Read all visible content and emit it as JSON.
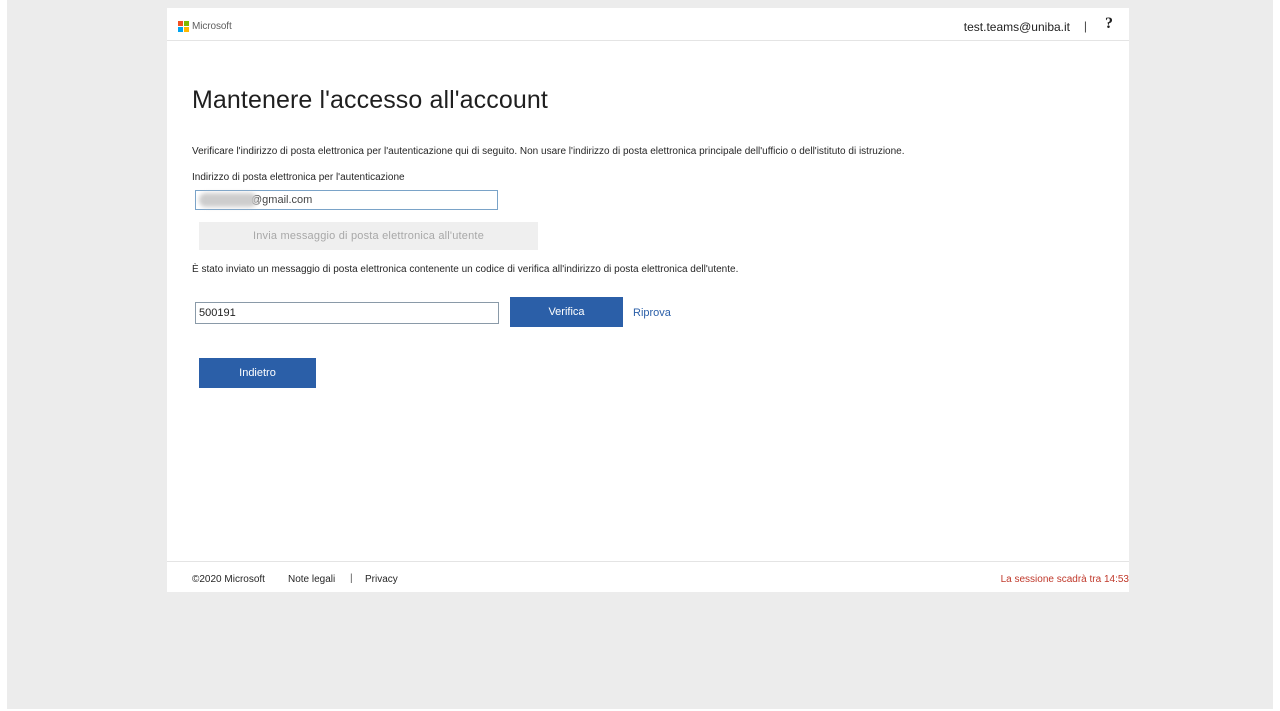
{
  "header": {
    "brand": "Microsoft",
    "user_email": "test.teams@uniba.it",
    "separator": "|",
    "help": "?"
  },
  "main": {
    "title": "Mantenere l'accesso all'account",
    "description": "Verificare l'indirizzo di posta elettronica per l'autenticazione qui di seguito. Non usare l'indirizzo di posta elettronica principale dell'ufficio o dell'istituto di istruzione.",
    "email_label": "Indirizzo di posta elettronica per l'autenticazione",
    "email_value": "@gmail.com",
    "send_button": "Invia messaggio di posta elettronica all'utente",
    "sent_message": "È stato inviato un messaggio di posta elettronica contenente un codice di verifica all'indirizzo di posta elettronica dell'utente.",
    "code_value": "500191",
    "verify_button": "Verifica",
    "retry_link": "Riprova",
    "back_button": "Indietro"
  },
  "footer": {
    "copyright": "©2020 Microsoft",
    "legal": "Note legali",
    "separator": "|",
    "privacy": "Privacy",
    "session_text": "La sessione scadrà tra 14:53"
  },
  "colors": {
    "accent": "#2b5fa8",
    "session_warning": "#c0392b",
    "page_background": "#ececec"
  }
}
